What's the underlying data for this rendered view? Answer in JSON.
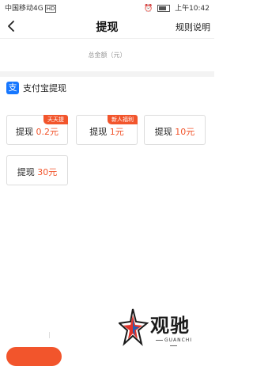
{
  "status_bar": {
    "carrier": "中国移动4G",
    "network_badge": "HD",
    "signal": "ᵃᶦ",
    "time": "上午10:42"
  },
  "nav": {
    "title": "提现",
    "rules_label": "规则说明"
  },
  "total": {
    "label": "总金额（元）"
  },
  "alipay": {
    "logo_char": "支",
    "title": "支付宝提现"
  },
  "withdraw_options": [
    {
      "prefix": "提现 ",
      "amount": "0.2元",
      "badge": "天天提"
    },
    {
      "prefix": "提现 ",
      "amount": "1元",
      "badge": "新人福利"
    },
    {
      "prefix": "提现 ",
      "amount": "10元",
      "badge": ""
    },
    {
      "prefix": "提现 ",
      "amount": "30元",
      "badge": ""
    }
  ],
  "watermark": {
    "main": "观驰",
    "sub": "GUANCHI"
  },
  "colors": {
    "accent": "#f2552c",
    "alipay_blue": "#1677ff"
  },
  "icons": {
    "back": "chevron-left-icon",
    "alipay": "alipay-logo-icon"
  }
}
